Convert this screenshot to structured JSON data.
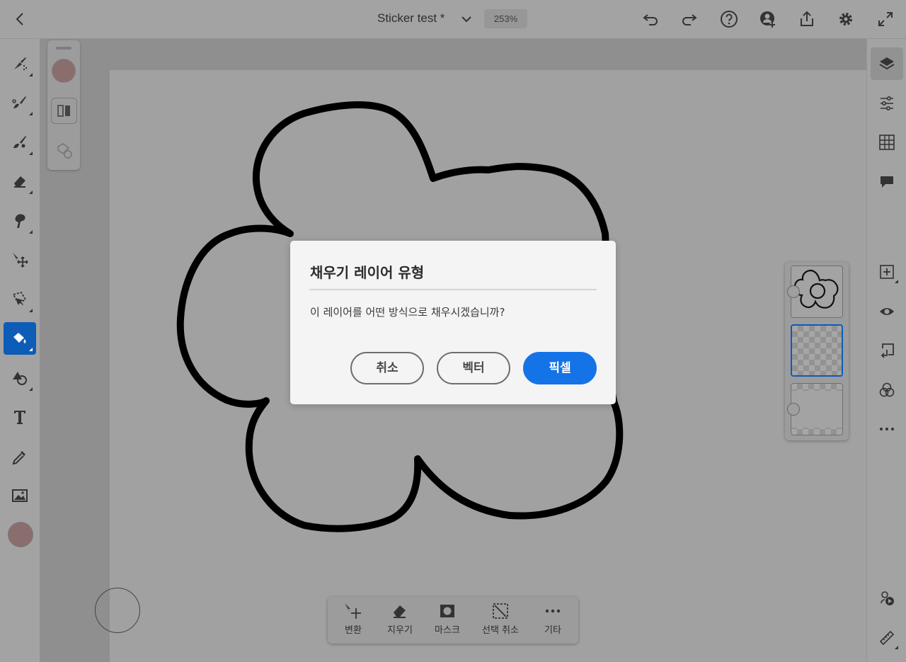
{
  "header": {
    "back_icon": "chevron-left-icon",
    "document_title": "Sticker test *",
    "zoom_level": "253%",
    "actions": [
      "undo-icon",
      "redo-icon",
      "help-icon",
      "invite-icon",
      "share-icon",
      "settings-icon",
      "fullscreen-icon"
    ]
  },
  "left_tools": [
    "pixel-brush-icon",
    "live-brush-icon",
    "vector-brush-icon",
    "eraser-icon",
    "smudge-icon",
    "transform-icon",
    "selection-icon",
    "fill-icon",
    "shapes-icon",
    "text-icon",
    "eyedropper-icon",
    "image-icon"
  ],
  "active_tool": "fill-icon",
  "colors": {
    "accent": "#1473e6",
    "swatch": "#8a6e6e"
  },
  "right_tools": [
    "layers-icon",
    "layer-properties-icon",
    "grid-icon",
    "comments-icon",
    "add-layer-icon",
    "visibility-icon",
    "merge-down-icon",
    "blend-mode-icon",
    "more-icon",
    "shape-tools-icon",
    "ruler-icon"
  ],
  "action_bar": {
    "items": [
      {
        "icon": "transform-icon",
        "label": "변환"
      },
      {
        "icon": "eraser-icon",
        "label": "지우기"
      },
      {
        "icon": "mask-icon",
        "label": "마스크"
      },
      {
        "icon": "deselect-icon",
        "label": "선택 취소"
      },
      {
        "icon": "more-icon",
        "label": "기타"
      }
    ]
  },
  "dialog": {
    "title": "채우기 레이어 유형",
    "message": "이 레이어를 어떤 방식으로 채우시겠습니까?",
    "cancel_label": "취소",
    "vector_label": "벡터",
    "pixel_label": "픽셀"
  }
}
